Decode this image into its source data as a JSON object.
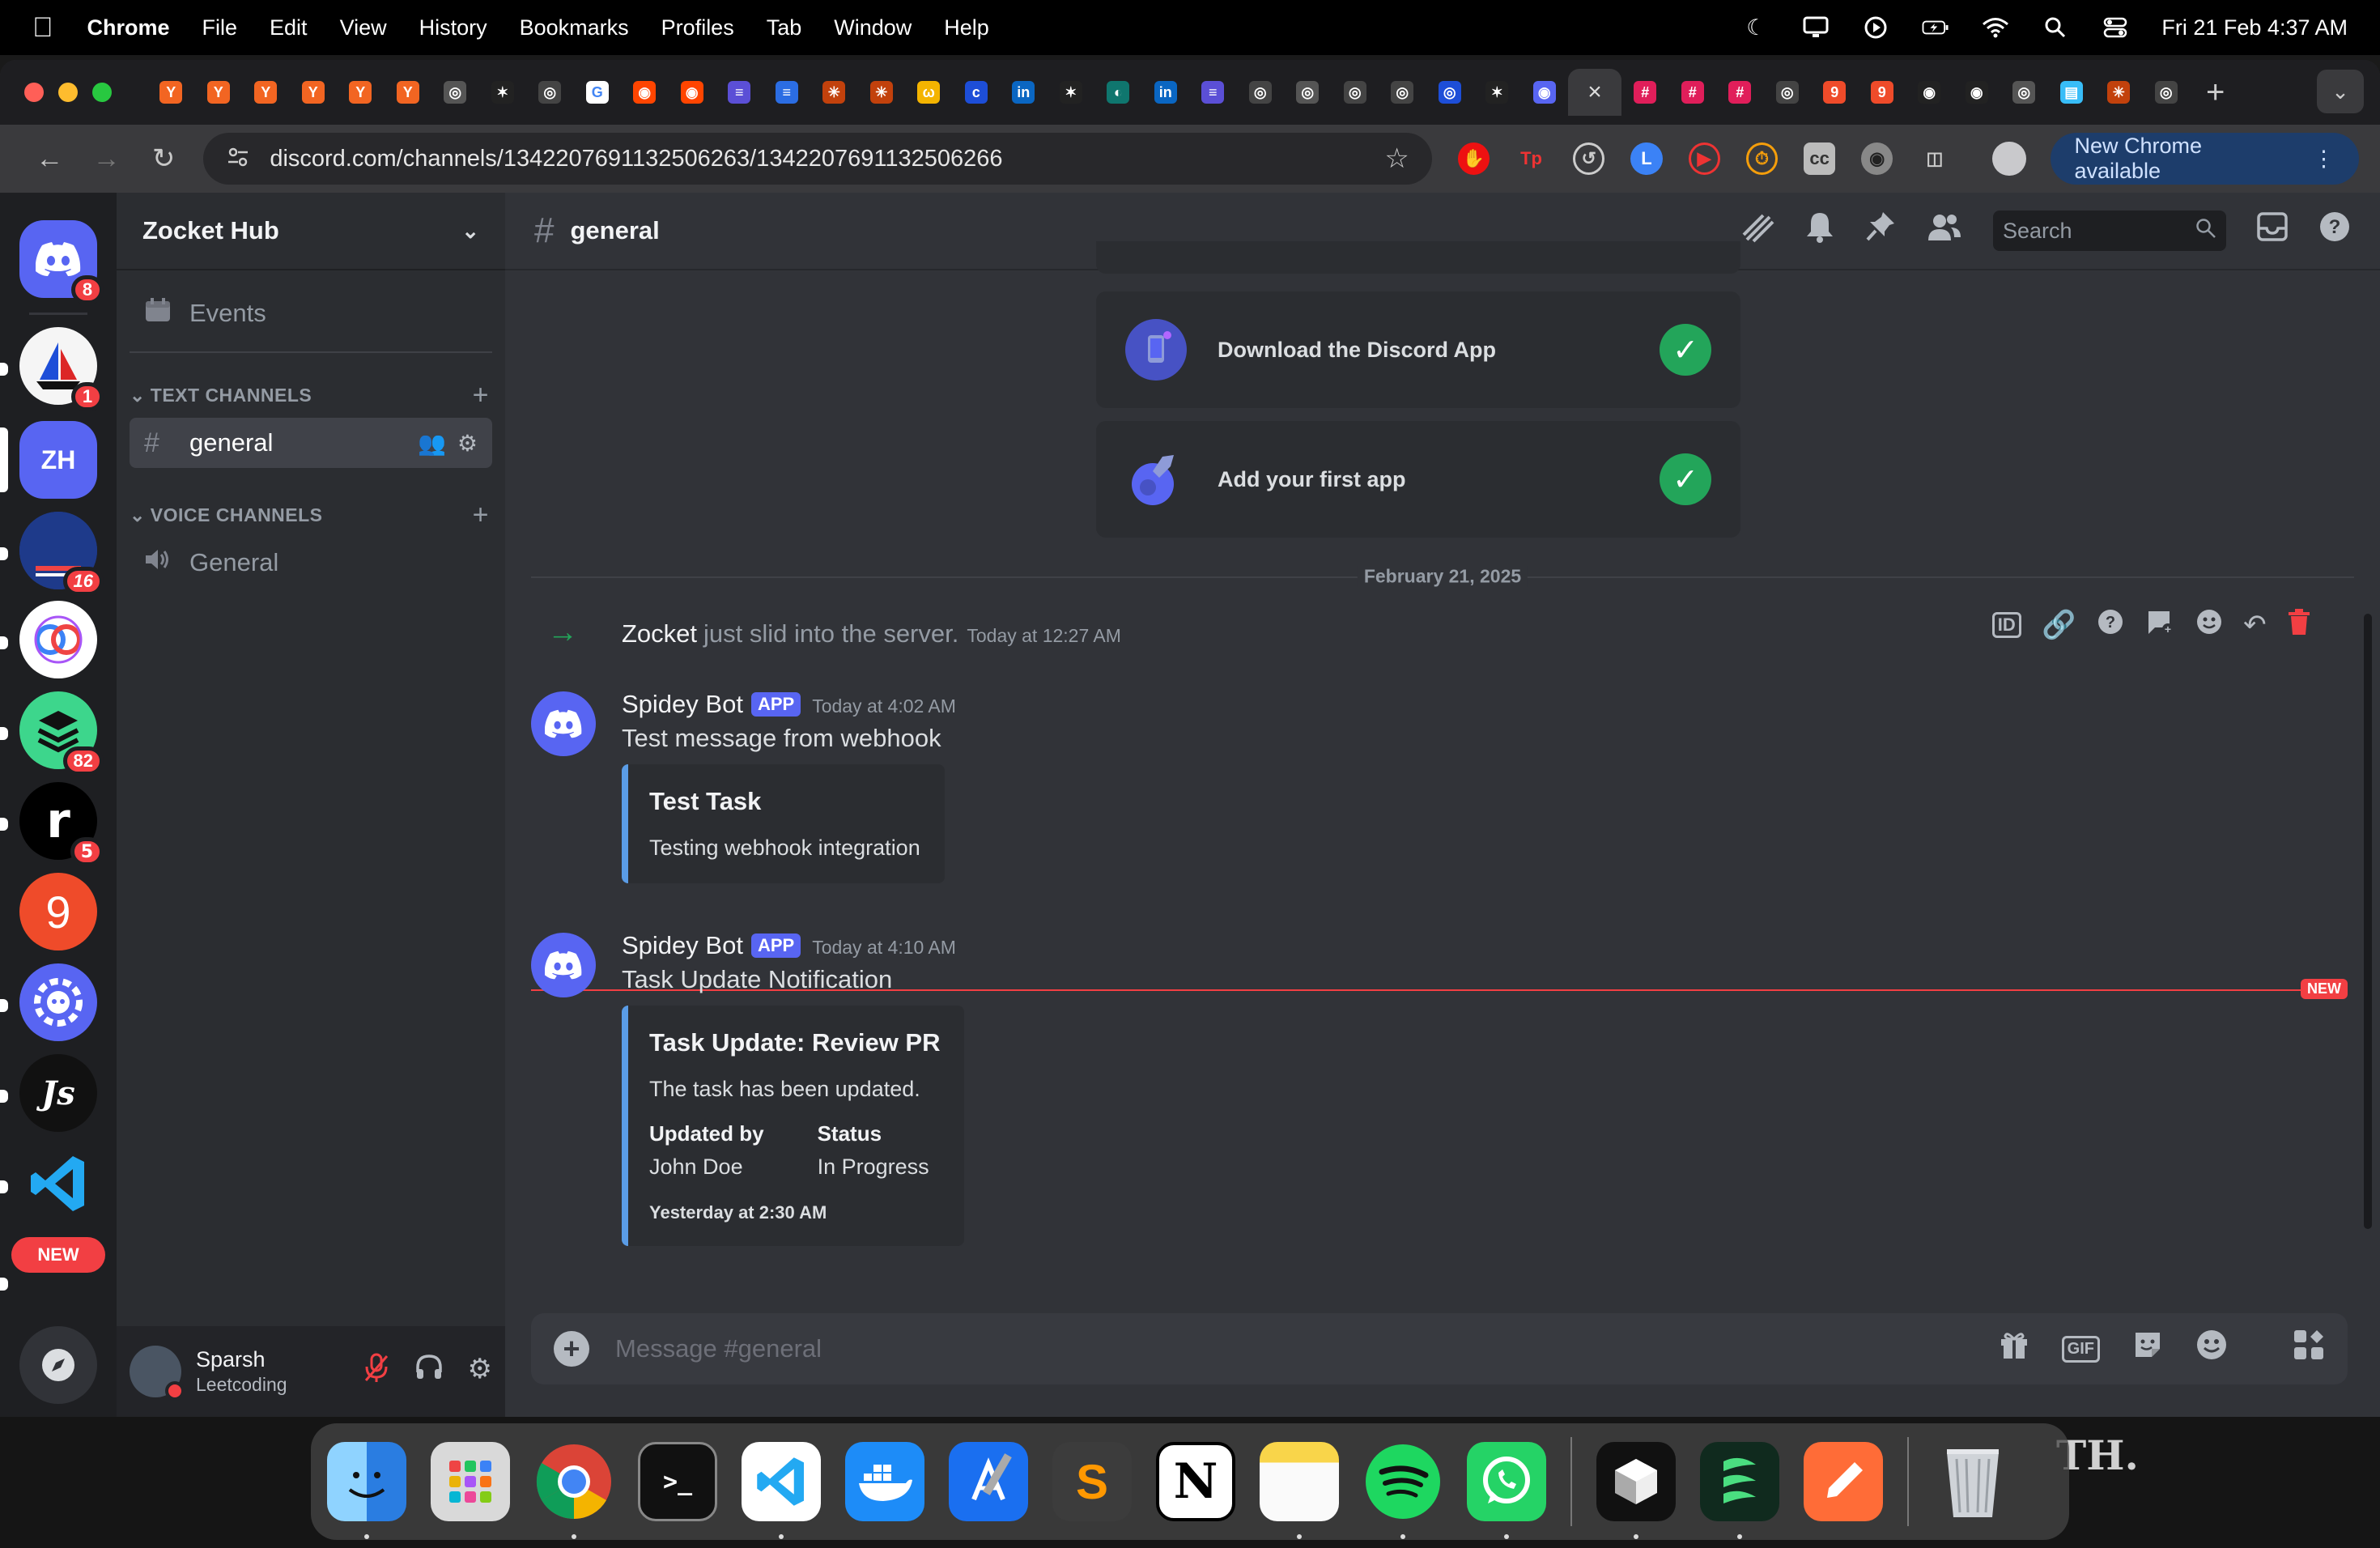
{
  "menubar": {
    "items": [
      "Chrome",
      "File",
      "Edit",
      "View",
      "History",
      "Bookmarks",
      "Profiles",
      "Tab",
      "Window",
      "Help"
    ],
    "datetime": "Fri 21 Feb  4:37 AM"
  },
  "browser": {
    "url": "discord.com/channels/1342207691132506263/1342207691132506266",
    "update_label": "New Chrome available",
    "tab_count": 44
  },
  "server_list": {
    "items": [
      {
        "name": "direct-messages",
        "badge": "8"
      },
      {
        "name": "server-sailboat",
        "badge": "1"
      },
      {
        "name": "server-zocket-hub",
        "initials": "ZH",
        "selected": true
      },
      {
        "name": "server-english-hub",
        "badge": "16"
      },
      {
        "name": "server-rings",
        "badge": ""
      },
      {
        "name": "server-stack",
        "badge": "82"
      },
      {
        "name": "server-r",
        "badge": "5"
      },
      {
        "name": "server-nine",
        "badge": ""
      },
      {
        "name": "server-discord-gear",
        "badge": ""
      },
      {
        "name": "server-js",
        "badge": ""
      },
      {
        "name": "server-vscode",
        "badge": ""
      }
    ],
    "new_label": "NEW"
  },
  "guild": {
    "name": "Zocket Hub",
    "events_label": "Events",
    "text_category": "TEXT CHANNELS",
    "voice_category": "VOICE CHANNELS",
    "text_channel": "general",
    "voice_channel": "General"
  },
  "user": {
    "name": "Sparsh",
    "status": "Leetcoding"
  },
  "channel": {
    "name": "general",
    "search_placeholder": "Search"
  },
  "onboarding": {
    "download_label": "Download the Discord App",
    "add_app_label": "Add your first app"
  },
  "date_divider": "February 21, 2025",
  "join_message": {
    "who": "Zocket",
    "text": "just slid into the server.",
    "time": "Today at 12:27 AM"
  },
  "messages": [
    {
      "author": "Spidey Bot",
      "tag": "APP",
      "time": "Today at 4:02 AM",
      "text": "Test message from webhook",
      "embed": {
        "title": "Test Task",
        "description": "Testing webhook integration"
      }
    },
    {
      "author": "Spidey Bot",
      "tag": "APP",
      "time": "Today at 4:10 AM",
      "text": "Task Update Notification",
      "embed": {
        "title": "Task Update: Review PR",
        "description": "The task has been updated.",
        "fields": [
          {
            "name": "Updated by",
            "value": "John Doe"
          },
          {
            "name": "Status",
            "value": "In Progress"
          }
        ],
        "footer": "Yesterday at 2:30 AM"
      }
    }
  ],
  "new_marker": "NEW",
  "composer": {
    "placeholder": "Message #general",
    "gif_label": "GIF"
  },
  "dock": {
    "apps": [
      "finder",
      "launchpad",
      "chrome",
      "terminal",
      "vscode",
      "docker",
      "xcode",
      "sublime-text",
      "notion",
      "notes",
      "spotify",
      "whatsapp",
      "cube",
      "sloth",
      "postman",
      "trash"
    ],
    "background_text": "TH."
  },
  "colors": {
    "blurple": "#5865f2",
    "green": "#23a55a",
    "red": "#f23f43",
    "embed_border": "#5a9ce6"
  }
}
